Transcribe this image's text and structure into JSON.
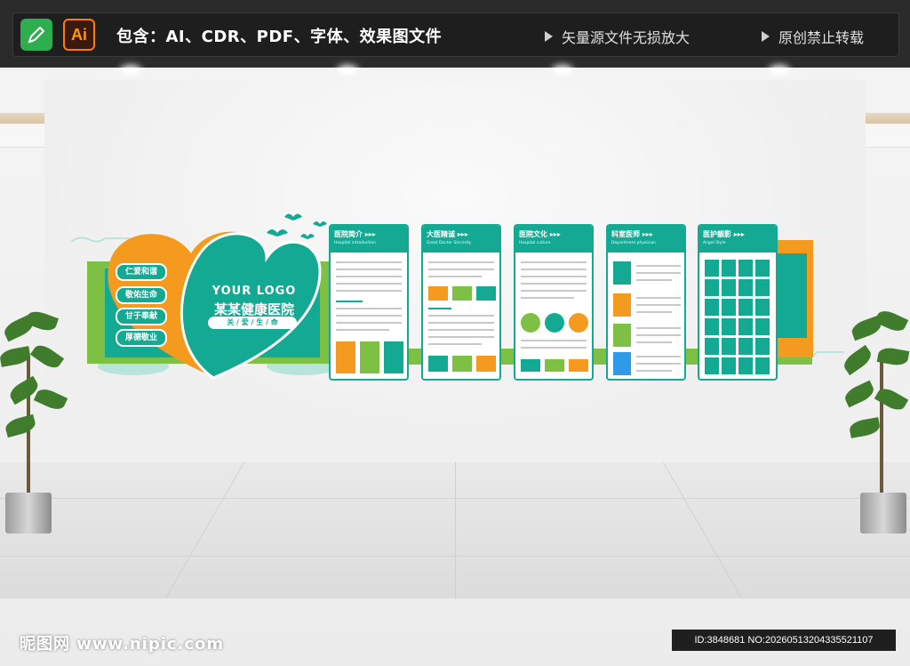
{
  "topbar": {
    "ai_badge": "Ai",
    "title": "包含：AI、CDR、PDF、字体、效果图文件",
    "note_vector": "矢量源文件无损放大",
    "note_original": "原创禁止转载"
  },
  "pills": [
    "仁爱和谐",
    "敬佑生命",
    "甘于奉献",
    "厚德敬业"
  ],
  "logo": {
    "en": "YOUR LOGO",
    "cn": "某某健康医院",
    "slogan": "关 / 爱 / 生 / 命"
  },
  "panels": [
    {
      "title": "医院简介 ▸▸▸",
      "subtitle": "Hospital introduction"
    },
    {
      "title": "大医精诚 ▸▸▸",
      "subtitle": "Great Doctor Sincerity"
    },
    {
      "title": "医院文化 ▸▸▸",
      "subtitle": "Hospital culture"
    },
    {
      "title": "科室医师 ▸▸▸",
      "subtitle": "Department physician"
    },
    {
      "title": "医护靓影 ▸▸▸",
      "subtitle": "Angel Style"
    }
  ],
  "colors": {
    "teal": "#14a993",
    "orange": "#f39a1f",
    "green": "#7ec043"
  },
  "icons": [
    "pen-icon",
    "illustrator-icon",
    "play-triangle-icon"
  ],
  "watermark": {
    "site": "昵图网 www.nipic.com",
    "id": "ID:3848681 NO:20260513204335521107"
  }
}
